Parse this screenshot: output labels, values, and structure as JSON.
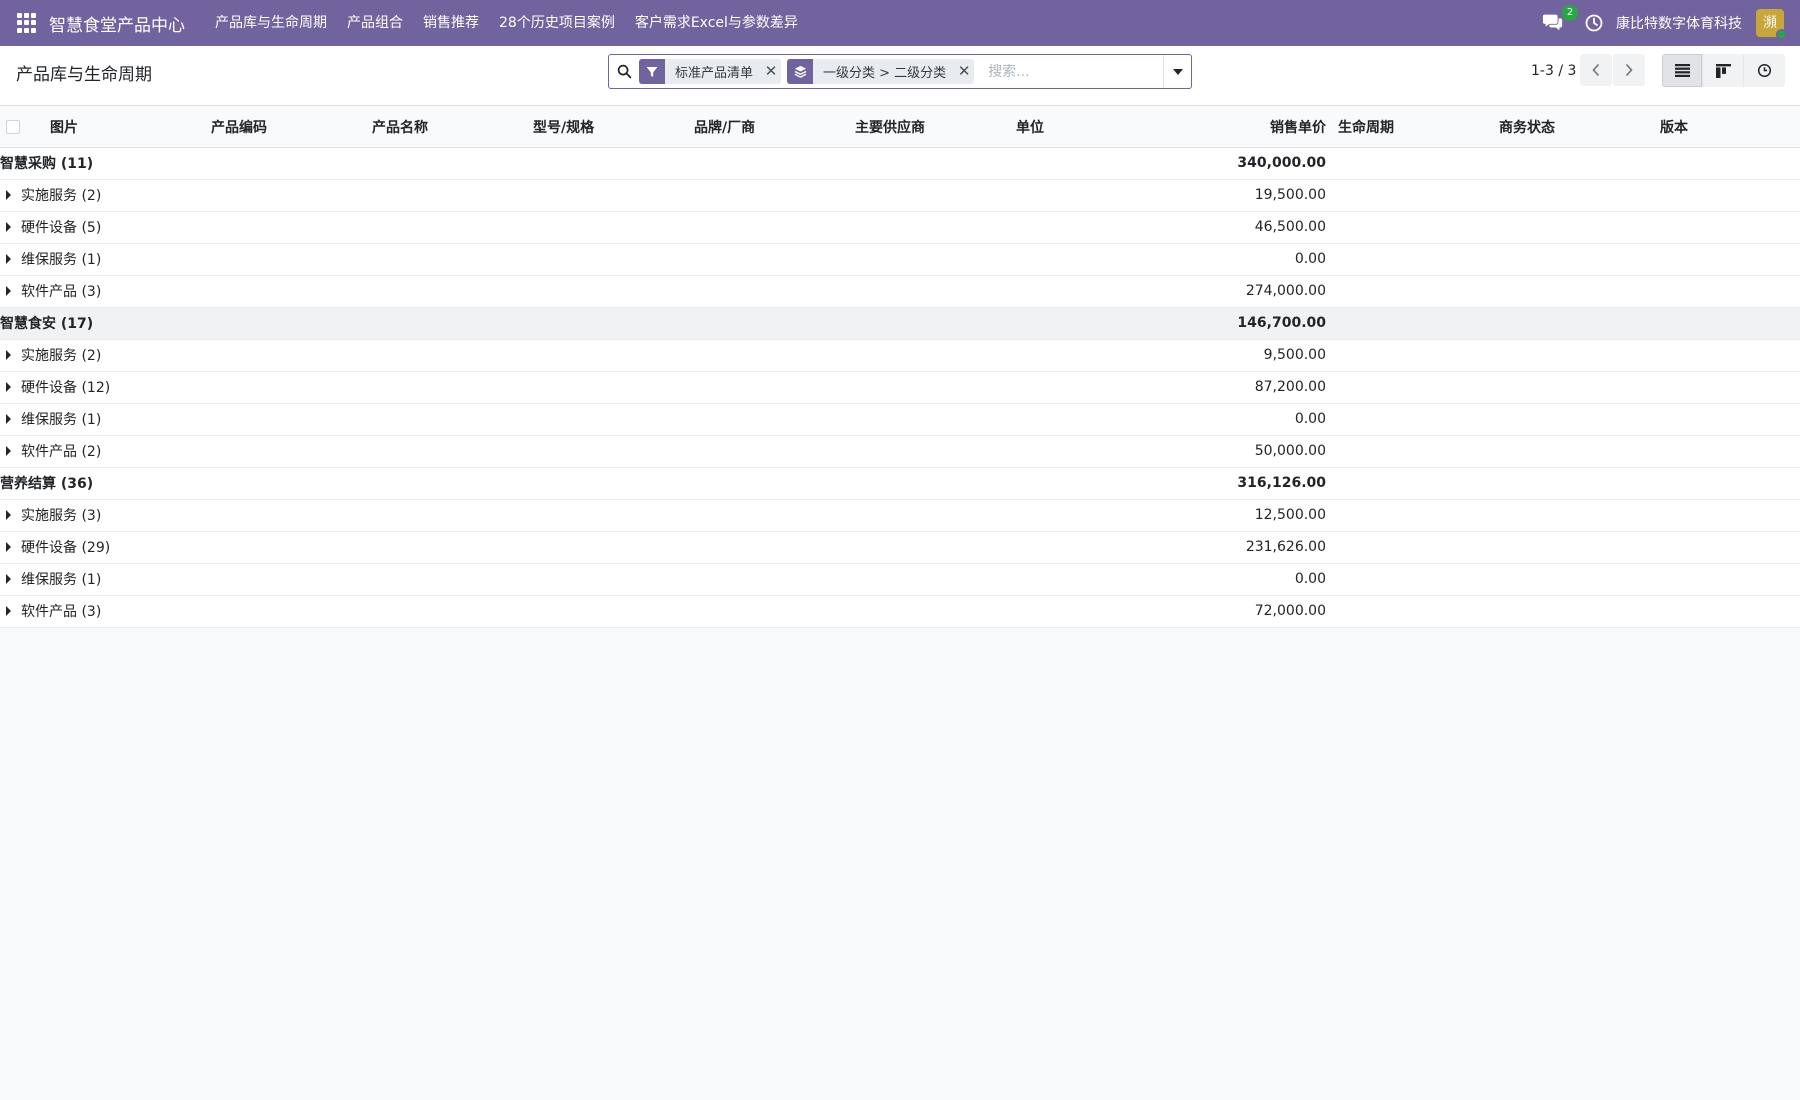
{
  "navbar": {
    "brand": "智慧食堂产品中心",
    "menu": [
      "产品库与生命周期",
      "产品组合",
      "销售推荐",
      "28个历史项目案例",
      "客户需求Excel与参数差异"
    ],
    "messages_count": "2",
    "company": "康比特数字体育科技",
    "avatar_initial": "瀕"
  },
  "control": {
    "title": "产品库与生命周期",
    "facets": [
      {
        "icon": "filter-icon",
        "label": "标准产品清单"
      },
      {
        "icon": "group-by-layers-icon",
        "label": "一级分类 > 二级分类"
      }
    ],
    "search_placeholder": "搜索...",
    "pager": "1-3 / 3"
  },
  "colors": {
    "navbar": "#71639e",
    "accent": "#71639e",
    "badge": "#28a745",
    "avatar": "#c8a63a"
  },
  "table": {
    "columns": [
      "图片",
      "产品编码",
      "产品名称",
      "型号/规格",
      "品牌/厂商",
      "主要供应商",
      "单位",
      "销售单价",
      "生命周期",
      "商务状态",
      "版本"
    ],
    "groups": [
      {
        "label": "智慧采购 (11)",
        "total": "340,000.00",
        "subgroups": [
          {
            "label": "实施服务 (2)",
            "total": "19,500.00"
          },
          {
            "label": "硬件设备 (5)",
            "total": "46,500.00"
          },
          {
            "label": "维保服务 (1)",
            "total": "0.00"
          },
          {
            "label": "软件产品 (3)",
            "total": "274,000.00"
          }
        ]
      },
      {
        "label": "智慧食安 (17)",
        "total": "146,700.00",
        "subgroups": [
          {
            "label": "实施服务 (2)",
            "total": "9,500.00"
          },
          {
            "label": "硬件设备 (12)",
            "total": "87,200.00"
          },
          {
            "label": "维保服务 (1)",
            "total": "0.00"
          },
          {
            "label": "软件产品 (2)",
            "total": "50,000.00"
          }
        ]
      },
      {
        "label": "营养结算 (36)",
        "total": "316,126.00",
        "subgroups": [
          {
            "label": "实施服务 (3)",
            "total": "12,500.00"
          },
          {
            "label": "硬件设备 (29)",
            "total": "231,626.00"
          },
          {
            "label": "维保服务 (1)",
            "total": "0.00"
          },
          {
            "label": "软件产品 (3)",
            "total": "72,000.00"
          }
        ]
      }
    ]
  }
}
